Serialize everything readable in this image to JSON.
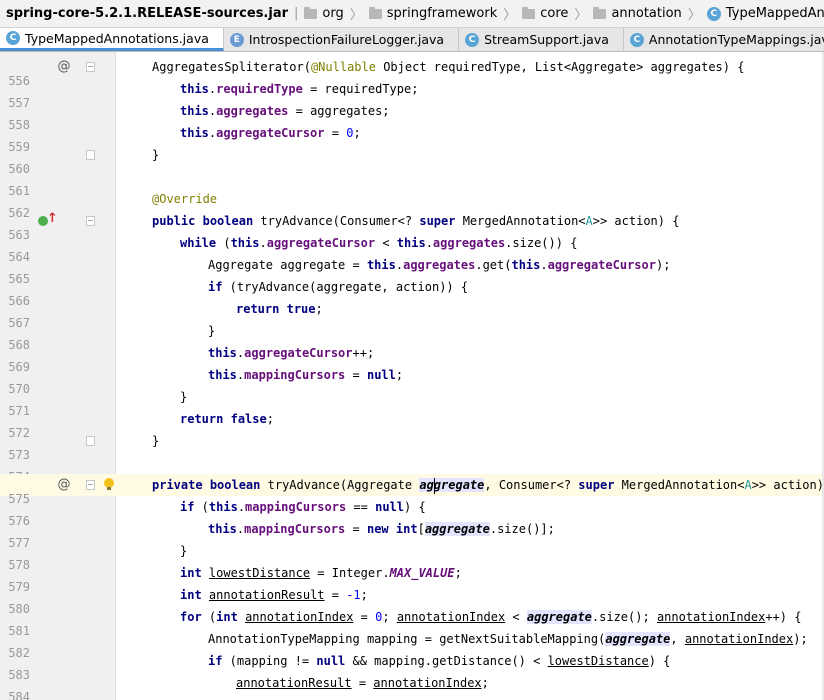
{
  "breadcrumb": {
    "items": [
      {
        "label": "spring-core-5.2.1.RELEASE-sources.jar",
        "icon": "jar"
      },
      {
        "label": "org",
        "icon": "folder-icon"
      },
      {
        "label": "springframework",
        "icon": "folder-icon"
      },
      {
        "label": "core",
        "icon": "folder-icon"
      },
      {
        "label": "annotation",
        "icon": "folder-icon"
      },
      {
        "label": "TypeMappedAnnotations",
        "icon": "class-icon"
      }
    ]
  },
  "tabs": [
    {
      "label": "TypeMappedAnnotations.java",
      "icon": "C",
      "active": true
    },
    {
      "label": "IntrospectionFailureLogger.java",
      "icon": "E",
      "active": false
    },
    {
      "label": "StreamSupport.java",
      "icon": "C",
      "active": false
    },
    {
      "label": "AnnotationTypeMappings.java",
      "icon": "C",
      "active": false
    }
  ],
  "editor": {
    "line_numbers": [
      "556",
      "557",
      "558",
      "559",
      "560",
      "561",
      "562",
      "563",
      "564",
      "565",
      "566",
      "567",
      "568",
      "569",
      "570",
      "571",
      "572",
      "573",
      "574",
      "575",
      "576",
      "577",
      "578",
      "579",
      "580",
      "581",
      "582",
      "583",
      "584"
    ],
    "tokens": {
      "aggregates_spliterator": "AggregatesSpliterator(",
      "nullable": "@Nullable",
      "object_required_type": " Object requiredType, List<Aggregate> aggregates) {",
      "this": "this",
      "required_type": "requiredType",
      "eq_required_type": " = requiredType;",
      "aggregates": "aggregates",
      "eq_aggregates": " = aggregates;",
      "aggregate_cursor": "aggregateCursor",
      "eq": " = ",
      "zero": "0",
      "semi": ";",
      "close_brace": "}",
      "override": "@Override",
      "public": "public",
      "boolean": "boolean",
      "try_advance_consumer": " tryAdvance(Consumer<? ",
      "super": "super",
      "merged_annotation": " MergedAnnotation<",
      "a": "A",
      "action_open": ">> action) {",
      "while": "while",
      "open_paren": " (",
      "lt": " < ",
      "size_open": ".size()) {",
      "aggregate_decl": "Aggregate aggregate = ",
      "get_open": ".get(",
      "close_paren_semi": ");",
      "if": "if",
      "try_advance_call": " (tryAdvance(aggregate, action)) {",
      "return": "return",
      "true": "true",
      "false": "false",
      "plus_plus": "++;",
      "mapping_cursors": "mappingCursors",
      "null": "null",
      "private": "private",
      "try_advance_aggregate": " tryAdvance(Aggregate ",
      "ag": "ag",
      "gregate": "gregate",
      "comma_consumer": ", Consumer<? ",
      "aggregate": "aggregate",
      "eqeq": " == ",
      "close_paren_open": ") {",
      "new": "new",
      "int": "int",
      "open_bracket": "[",
      "size_close_bracket": ".size()];",
      "lowest_distance": "lowestDistance",
      "eq_integer": " = Integer.",
      "max_value": "MAX_VALUE",
      "annotation_result": "annotationResult",
      "eq_minus_one": " = ",
      "minus_one": "-1",
      "for": "for",
      "annotation_index": "annotationIndex",
      "semi_space": "; ",
      "size_semi": ".size(); ",
      "plus_plus_close": "++) {",
      "mapping_decl": "AnnotationTypeMapping mapping = getNextSuitableMapping(",
      "comma_space": ", ",
      "mapping_ne": " (mapping != ",
      "and_distance": " && mapping.getDistance() < ",
      "eq_plain": " = ",
      "semi_end": ";"
    }
  },
  "colors": {
    "keyword": "#000080",
    "field": "#660e7a",
    "annotation": "#808000",
    "number": "#0000ff",
    "current_line": "#fffae3",
    "active_tab_underline": "#4a90d9"
  }
}
